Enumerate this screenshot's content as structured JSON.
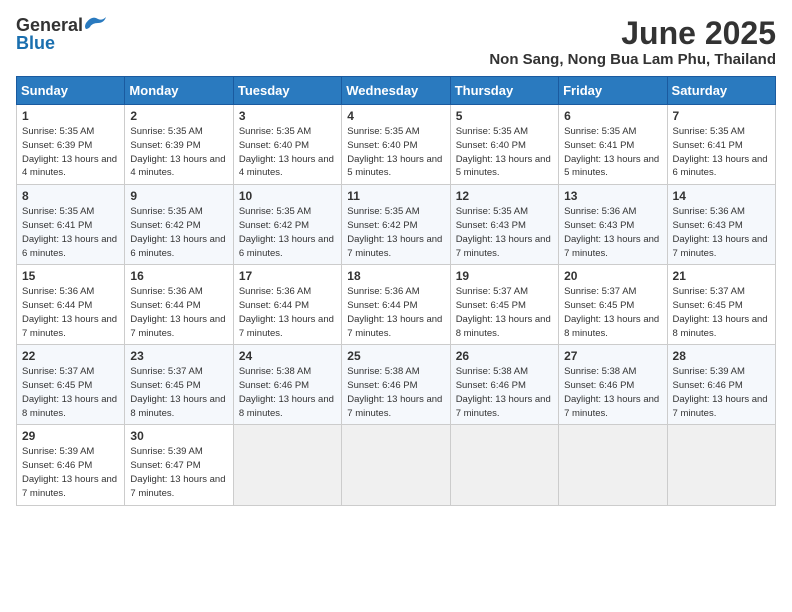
{
  "header": {
    "logo_general": "General",
    "logo_blue": "Blue",
    "month": "June 2025",
    "location": "Non Sang, Nong Bua Lam Phu, Thailand"
  },
  "days_of_week": [
    "Sunday",
    "Monday",
    "Tuesday",
    "Wednesday",
    "Thursday",
    "Friday",
    "Saturday"
  ],
  "weeks": [
    [
      {
        "day": 1,
        "sunrise": "5:35 AM",
        "sunset": "6:39 PM",
        "daylight": "13 hours and 4 minutes."
      },
      {
        "day": 2,
        "sunrise": "5:35 AM",
        "sunset": "6:39 PM",
        "daylight": "13 hours and 4 minutes."
      },
      {
        "day": 3,
        "sunrise": "5:35 AM",
        "sunset": "6:40 PM",
        "daylight": "13 hours and 4 minutes."
      },
      {
        "day": 4,
        "sunrise": "5:35 AM",
        "sunset": "6:40 PM",
        "daylight": "13 hours and 5 minutes."
      },
      {
        "day": 5,
        "sunrise": "5:35 AM",
        "sunset": "6:40 PM",
        "daylight": "13 hours and 5 minutes."
      },
      {
        "day": 6,
        "sunrise": "5:35 AM",
        "sunset": "6:41 PM",
        "daylight": "13 hours and 5 minutes."
      },
      {
        "day": 7,
        "sunrise": "5:35 AM",
        "sunset": "6:41 PM",
        "daylight": "13 hours and 6 minutes."
      }
    ],
    [
      {
        "day": 8,
        "sunrise": "5:35 AM",
        "sunset": "6:41 PM",
        "daylight": "13 hours and 6 minutes."
      },
      {
        "day": 9,
        "sunrise": "5:35 AM",
        "sunset": "6:42 PM",
        "daylight": "13 hours and 6 minutes."
      },
      {
        "day": 10,
        "sunrise": "5:35 AM",
        "sunset": "6:42 PM",
        "daylight": "13 hours and 6 minutes."
      },
      {
        "day": 11,
        "sunrise": "5:35 AM",
        "sunset": "6:42 PM",
        "daylight": "13 hours and 7 minutes."
      },
      {
        "day": 12,
        "sunrise": "5:35 AM",
        "sunset": "6:43 PM",
        "daylight": "13 hours and 7 minutes."
      },
      {
        "day": 13,
        "sunrise": "5:36 AM",
        "sunset": "6:43 PM",
        "daylight": "13 hours and 7 minutes."
      },
      {
        "day": 14,
        "sunrise": "5:36 AM",
        "sunset": "6:43 PM",
        "daylight": "13 hours and 7 minutes."
      }
    ],
    [
      {
        "day": 15,
        "sunrise": "5:36 AM",
        "sunset": "6:44 PM",
        "daylight": "13 hours and 7 minutes."
      },
      {
        "day": 16,
        "sunrise": "5:36 AM",
        "sunset": "6:44 PM",
        "daylight": "13 hours and 7 minutes."
      },
      {
        "day": 17,
        "sunrise": "5:36 AM",
        "sunset": "6:44 PM",
        "daylight": "13 hours and 7 minutes."
      },
      {
        "day": 18,
        "sunrise": "5:36 AM",
        "sunset": "6:44 PM",
        "daylight": "13 hours and 7 minutes."
      },
      {
        "day": 19,
        "sunrise": "5:37 AM",
        "sunset": "6:45 PM",
        "daylight": "13 hours and 8 minutes."
      },
      {
        "day": 20,
        "sunrise": "5:37 AM",
        "sunset": "6:45 PM",
        "daylight": "13 hours and 8 minutes."
      },
      {
        "day": 21,
        "sunrise": "5:37 AM",
        "sunset": "6:45 PM",
        "daylight": "13 hours and 8 minutes."
      }
    ],
    [
      {
        "day": 22,
        "sunrise": "5:37 AM",
        "sunset": "6:45 PM",
        "daylight": "13 hours and 8 minutes."
      },
      {
        "day": 23,
        "sunrise": "5:37 AM",
        "sunset": "6:45 PM",
        "daylight": "13 hours and 8 minutes."
      },
      {
        "day": 24,
        "sunrise": "5:38 AM",
        "sunset": "6:46 PM",
        "daylight": "13 hours and 8 minutes."
      },
      {
        "day": 25,
        "sunrise": "5:38 AM",
        "sunset": "6:46 PM",
        "daylight": "13 hours and 7 minutes."
      },
      {
        "day": 26,
        "sunrise": "5:38 AM",
        "sunset": "6:46 PM",
        "daylight": "13 hours and 7 minutes."
      },
      {
        "day": 27,
        "sunrise": "5:38 AM",
        "sunset": "6:46 PM",
        "daylight": "13 hours and 7 minutes."
      },
      {
        "day": 28,
        "sunrise": "5:39 AM",
        "sunset": "6:46 PM",
        "daylight": "13 hours and 7 minutes."
      }
    ],
    [
      {
        "day": 29,
        "sunrise": "5:39 AM",
        "sunset": "6:46 PM",
        "daylight": "13 hours and 7 minutes."
      },
      {
        "day": 30,
        "sunrise": "5:39 AM",
        "sunset": "6:47 PM",
        "daylight": "13 hours and 7 minutes."
      },
      null,
      null,
      null,
      null,
      null
    ]
  ]
}
